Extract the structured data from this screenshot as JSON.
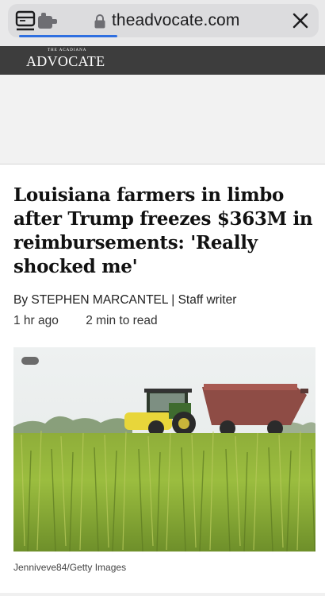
{
  "browser": {
    "url": "theadvocate.com",
    "icons": [
      "tab-overview-icon",
      "extension-icon",
      "lock-icon",
      "close-icon"
    ]
  },
  "masthead": {
    "logo_small": "THE ACADIANA",
    "logo_big": "ADVOCATE"
  },
  "article": {
    "headline": "Louisiana farmers in limbo after Trump freezes $363M in reimbursements: 'Really shocked me'",
    "byline": "By STEPHEN MARCANTEL | Staff writer",
    "time_ago": "1 hr ago",
    "read_time": "2 min to read",
    "photo_caption": "Jenniveve84/Getty Images"
  },
  "colors": {
    "masthead_bg": "#3d3d3d",
    "load_bar": "#2f6fe0"
  }
}
